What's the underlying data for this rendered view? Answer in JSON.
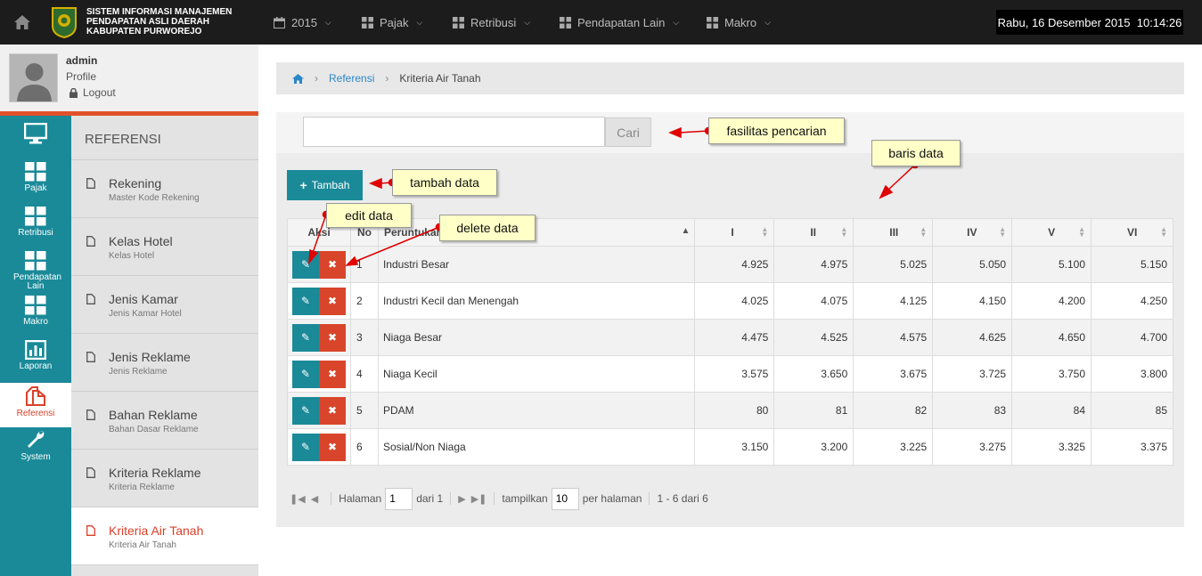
{
  "app": {
    "title_lines": [
      "SISTEM INFORMASI MANAJEMEN",
      "PENDAPATAN ASLI DAERAH",
      "KABUPATEN PURWOREJO"
    ]
  },
  "topmenu": [
    {
      "label": "2015",
      "icon": "calendar-icon"
    },
    {
      "label": "Pajak",
      "icon": "grid-icon"
    },
    {
      "label": "Retribusi",
      "icon": "grid-icon"
    },
    {
      "label": "Pendapatan Lain",
      "icon": "grid-icon"
    },
    {
      "label": "Makro",
      "icon": "grid-icon"
    }
  ],
  "clock": "Rabu, 16 Desember 2015  10:14:26",
  "user": {
    "name": "admin",
    "profile": "Profile",
    "logout": "Logout"
  },
  "iconnav": [
    {
      "label": "",
      "icon": "monitor-icon"
    },
    {
      "label": "Pajak",
      "icon": "grid-icon"
    },
    {
      "label": "Retribusi",
      "icon": "grid-icon"
    },
    {
      "label": "Pendapatan Lain",
      "icon": "grid-icon"
    },
    {
      "label": "Makro",
      "icon": "grid-icon"
    },
    {
      "label": "Laporan",
      "icon": "chart-icon"
    },
    {
      "label": "Referensi",
      "icon": "copy-icon",
      "active": true
    },
    {
      "label": "System",
      "icon": "wrench-icon"
    }
  ],
  "submenu": {
    "heading": "REFERENSI",
    "items": [
      {
        "title": "Rekening",
        "subtitle": "Master Kode Rekening"
      },
      {
        "title": "Kelas Hotel",
        "subtitle": "Kelas Hotel"
      },
      {
        "title": "Jenis Kamar",
        "subtitle": "Jenis Kamar Hotel"
      },
      {
        "title": "Jenis Reklame",
        "subtitle": "Jenis Reklame"
      },
      {
        "title": "Bahan Reklame",
        "subtitle": "Bahan Dasar Reklame"
      },
      {
        "title": "Kriteria Reklame",
        "subtitle": "Kriteria Reklame"
      },
      {
        "title": "Kriteria Air Tanah",
        "subtitle": "Kriteria Air Tanah",
        "active": true
      }
    ]
  },
  "breadcrumb": {
    "link": "Referensi",
    "current": "Kriteria Air Tanah"
  },
  "search": {
    "value": "",
    "button": "Cari"
  },
  "add_button": "Tambah",
  "table": {
    "columns": [
      "Aksi",
      "No",
      "Peruntukan",
      "I",
      "II",
      "III",
      "IV",
      "V",
      "VI"
    ],
    "rows": [
      {
        "no": "1",
        "name": "Industri Besar",
        "values": [
          "4.925",
          "4.975",
          "5.025",
          "5.050",
          "5.100",
          "5.150"
        ]
      },
      {
        "no": "2",
        "name": "Industri Kecil dan Menengah",
        "values": [
          "4.025",
          "4.075",
          "4.125",
          "4.150",
          "4.200",
          "4.250"
        ]
      },
      {
        "no": "3",
        "name": "Niaga Besar",
        "values": [
          "4.475",
          "4.525",
          "4.575",
          "4.625",
          "4.650",
          "4.700"
        ]
      },
      {
        "no": "4",
        "name": "Niaga Kecil",
        "values": [
          "3.575",
          "3.650",
          "3.675",
          "3.725",
          "3.750",
          "3.800"
        ]
      },
      {
        "no": "5",
        "name": "PDAM",
        "values": [
          "80",
          "81",
          "82",
          "83",
          "84",
          "85"
        ]
      },
      {
        "no": "6",
        "name": "Sosial/Non Niaga",
        "values": [
          "3.150",
          "3.200",
          "3.225",
          "3.275",
          "3.325",
          "3.375"
        ]
      }
    ]
  },
  "pager": {
    "page_label": "Halaman",
    "page_value": "1",
    "of_label": "dari 1",
    "show_label": "tampilkan",
    "show_value": "10",
    "per_page_label": "per halaman",
    "summary": "1 - 6 dari 6"
  },
  "callouts": {
    "search": "fasilitas pencarian",
    "rows": "baris data",
    "add": "tambah data",
    "edit": "edit data",
    "delete": "delete data"
  },
  "colors": {
    "accent": "#1a8a99",
    "danger": "#d9452a",
    "active_text": "#d9412a",
    "topbar": "#1c1c1c",
    "callout": "#ffffc8"
  }
}
